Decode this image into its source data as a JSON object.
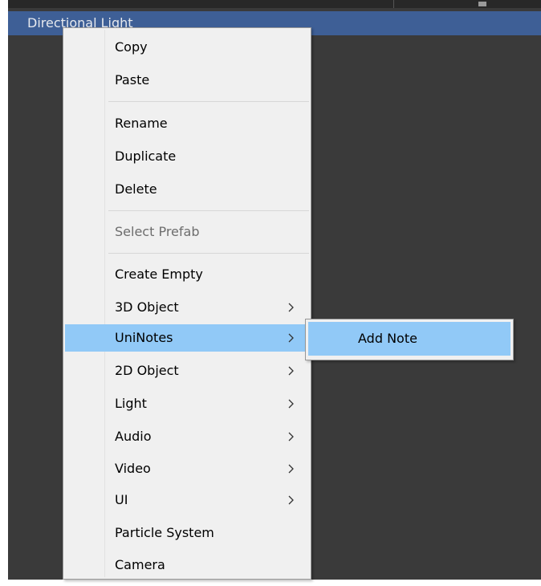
{
  "hierarchy": {
    "selected_object": "Directional Light"
  },
  "context_menu": {
    "copy": "Copy",
    "paste": "Paste",
    "rename": "Rename",
    "duplicate": "Duplicate",
    "delete": "Delete",
    "select_prefab": "Select Prefab",
    "create_empty": "Create Empty",
    "object_3d": "3D Object",
    "uninotes": "UniNotes",
    "object_2d": "2D Object",
    "light": "Light",
    "audio": "Audio",
    "video": "Video",
    "ui": "UI",
    "particle_system": "Particle System",
    "camera": "Camera",
    "submenu_indicator_icon": "chevron-right-icon",
    "highlight_color": "#91c9f7"
  },
  "uninotes_submenu": {
    "add_note": "Add Note"
  },
  "colors": {
    "editor_background": "#3a3a3a",
    "selection": "#3e5f96",
    "menu_background": "#f0f0f0",
    "disabled_text": "#6d6d6d"
  }
}
